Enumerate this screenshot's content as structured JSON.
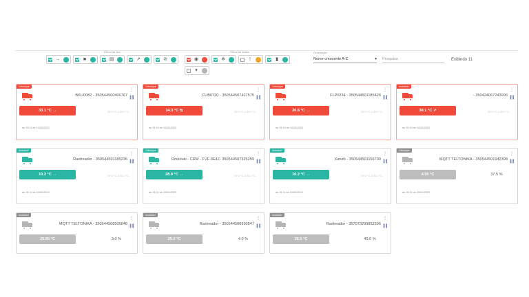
{
  "filters": {
    "type_label": "Filtros de tipo",
    "status_label": "Filtros de status",
    "type_chips": [
      {
        "icon": "→",
        "name": "arrow-icon"
      },
      {
        "icon": "■",
        "name": "truck-icon"
      },
      {
        "icon": "▤",
        "name": "container-icon"
      },
      {
        "icon": "↗",
        "name": "sensor-icon"
      },
      {
        "icon": "⊘",
        "name": "blocked-icon"
      }
    ],
    "status_chips": [
      {
        "icon": "◉",
        "name": "drop-icon"
      },
      {
        "icon": "❄",
        "name": "snowflake-icon"
      },
      {
        "icon": "!",
        "name": "warning-icon"
      },
      {
        "icon": "▮",
        "name": "thermometer-icon"
      },
      {
        "icon": "▾",
        "name": "wifi-icon"
      }
    ]
  },
  "ordering": {
    "label": "Ordenação",
    "value": "Nome crescente A-Z",
    "arrow": "▾"
  },
  "search": {
    "placeholder": "Pesquisa"
  },
  "showing": "Exibindo 11",
  "menu_glyph": "⋮",
  "stats_glyph": "▐▐",
  "cards": [
    {
      "badge": "Clássique",
      "color": "red",
      "title": "BKU0082 - 350544500406767",
      "temp": "33.1 °C →",
      "range": "25.0 °C a 30.0 °C",
      "humidity": "",
      "date": "às 15:11 de 10/03/2023"
    },
    {
      "badge": "Clássique",
      "color": "red",
      "title": "CUB0720 - 350544507427575",
      "temp": "34.3 °C ⇆",
      "range": "25.0 °C a 30.0 °C",
      "humidity": "",
      "date": "às 15:10 de 10/03/2023"
    },
    {
      "badge": "Clássique",
      "color": "red",
      "title": "FLP0234 - 350544501185426",
      "temp": "30.6 °C →",
      "range": "25.0 °C a 30.0 °C",
      "humidity": "",
      "date": "às 15:10 de 10/03/2023"
    },
    {
      "badge": "Instalado",
      "color": "red",
      "title": "- 350424067243996",
      "temp": "38.1 °C ↗",
      "range": "25.0 °C a 30.0 °C",
      "humidity": "",
      "date": "às 15:10 de 10/03/2023"
    },
    {
      "badge": "Instalado",
      "color": "teal",
      "title": "Rastreador - 350544501185236",
      "temp": "10.2 °C →",
      "range": "25.0 °C a 30.0 °C",
      "humidity": "",
      "date": "às 15:11 de 10/03/2023"
    },
    {
      "badge": "Clássique",
      "color": "teal",
      "title": "Rodoluki - CRM - FVF-9E42- 350544507325259",
      "temp": "28.0 °C →",
      "range": "25.0 °C a 30.0 °C",
      "humidity": "",
      "date": "às 15:10 de 10/03/2023"
    },
    {
      "badge": "Instalado",
      "color": "teal",
      "title": "Xandó - 350544501156700",
      "temp": "10.2 °C →",
      "range": "25.0 °C a 30.0 °C",
      "humidity": "",
      "date": "às 15:11 de 10/03/2023"
    },
    {
      "badge": "Clássique",
      "color": "grey",
      "title": "MQTT TELTONIKA - 350544501942398",
      "temp": "4.55 °C",
      "range": "",
      "humidity": "37.5 %",
      "date": "às 15:32 de 20/01/2023"
    },
    {
      "badge": "Instalado",
      "color": "grey",
      "title": "MQTT TELTONIKA - 350544508505648",
      "temp": "25.85 °C",
      "range": "",
      "humidity": "3.0 %",
      "date": ""
    },
    {
      "badge": "Instalado",
      "color": "grey",
      "title": "Rastreador - 350544506930547",
      "temp": "25.3 °C",
      "range": "",
      "humidity": "4.0 %",
      "date": ""
    },
    {
      "badge": "Instalado",
      "color": "grey",
      "title": "Rastreador - 357073299852596",
      "temp": "26.5 °C",
      "range": "",
      "humidity": "40.0 %",
      "date": ""
    }
  ]
}
